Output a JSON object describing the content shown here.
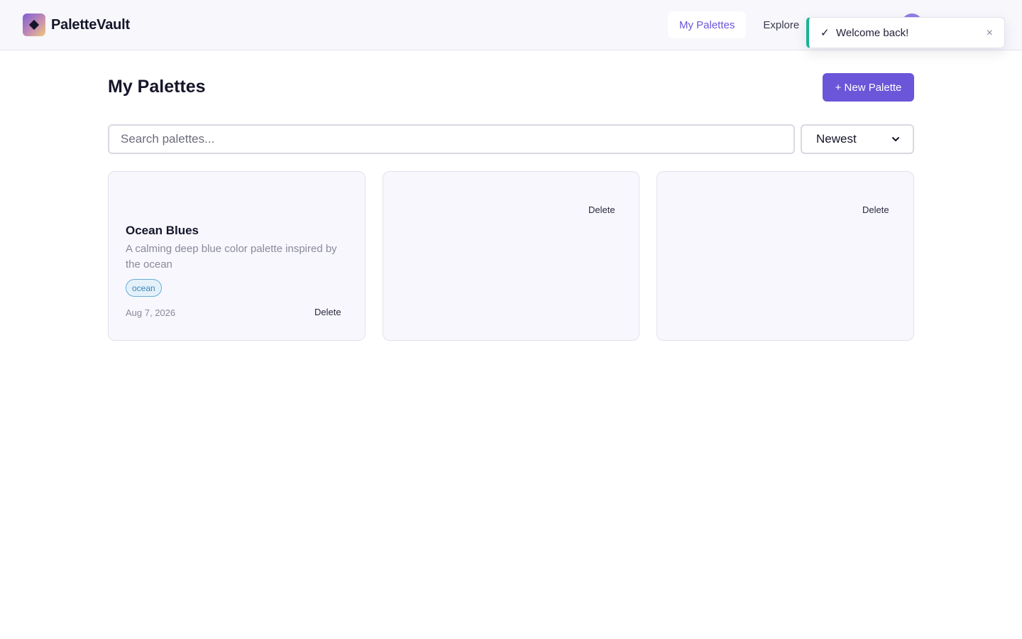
{
  "app": {
    "name": "PaletteVault"
  },
  "nav": {
    "items": [
      {
        "label": "My Palettes",
        "active": true
      },
      {
        "label": "Explore",
        "active": false
      }
    ]
  },
  "toast": {
    "check": "✓",
    "message": "Welcome back!",
    "close": "×",
    "accent_color": "#19b394"
  },
  "main": {
    "title": "My Palettes",
    "new_button_label": "+ New Palette",
    "search": {
      "placeholder": "Search palettes...",
      "value": ""
    },
    "sort": {
      "selected": "Newest"
    },
    "cards": [
      {
        "title": "Ocean Blues",
        "description": "A calming deep blue color palette inspired by the ocean",
        "tag": "ocean",
        "date": "Aug 7, 2026",
        "delete_label": "Delete"
      },
      {
        "delete_label": "Delete"
      },
      {
        "delete_label": "Delete"
      }
    ]
  },
  "colors": {
    "accent": "#6b55d9",
    "header_bg": "#f7f7fc",
    "card_bg": "#f7f7fd",
    "tag_border": "#6aaed6"
  },
  "icons": {
    "logo": "diamond-logo-icon",
    "check": "check-icon",
    "close": "close-icon",
    "select": "chevron-down-icon"
  }
}
